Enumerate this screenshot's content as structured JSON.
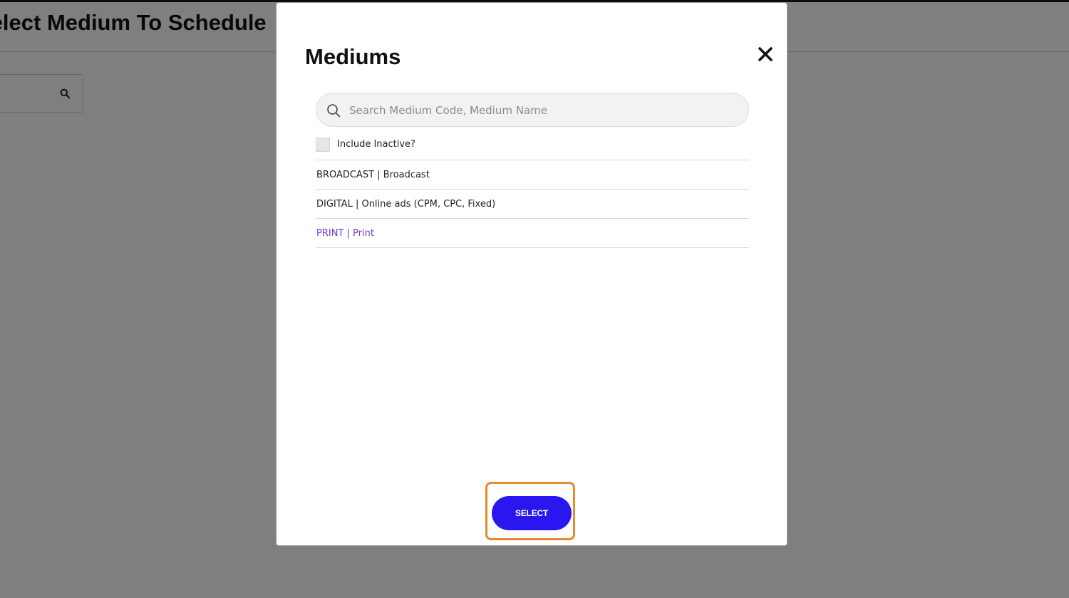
{
  "background_page": {
    "title": "Select Medium To Schedule",
    "search_icon": "search-icon"
  },
  "modal": {
    "title": "Mediums",
    "close_icon": "close-icon",
    "search": {
      "placeholder": "Search Medium Code, Medium Name",
      "value": "",
      "icon": "search-icon"
    },
    "include_inactive": {
      "label": "Include Inactive?",
      "checked": false
    },
    "items": [
      {
        "label": "BROADCAST | Broadcast",
        "selected": false
      },
      {
        "label": "DIGITAL | Online ads (CPM, CPC, Fixed)",
        "selected": false
      },
      {
        "label": "PRINT | Print",
        "selected": true
      }
    ],
    "select_button_label": "SELECT"
  },
  "colors": {
    "primary_button": "#2a17f0",
    "highlight_outline": "#e8892e",
    "selected_item_text": "#6b3ad6"
  }
}
